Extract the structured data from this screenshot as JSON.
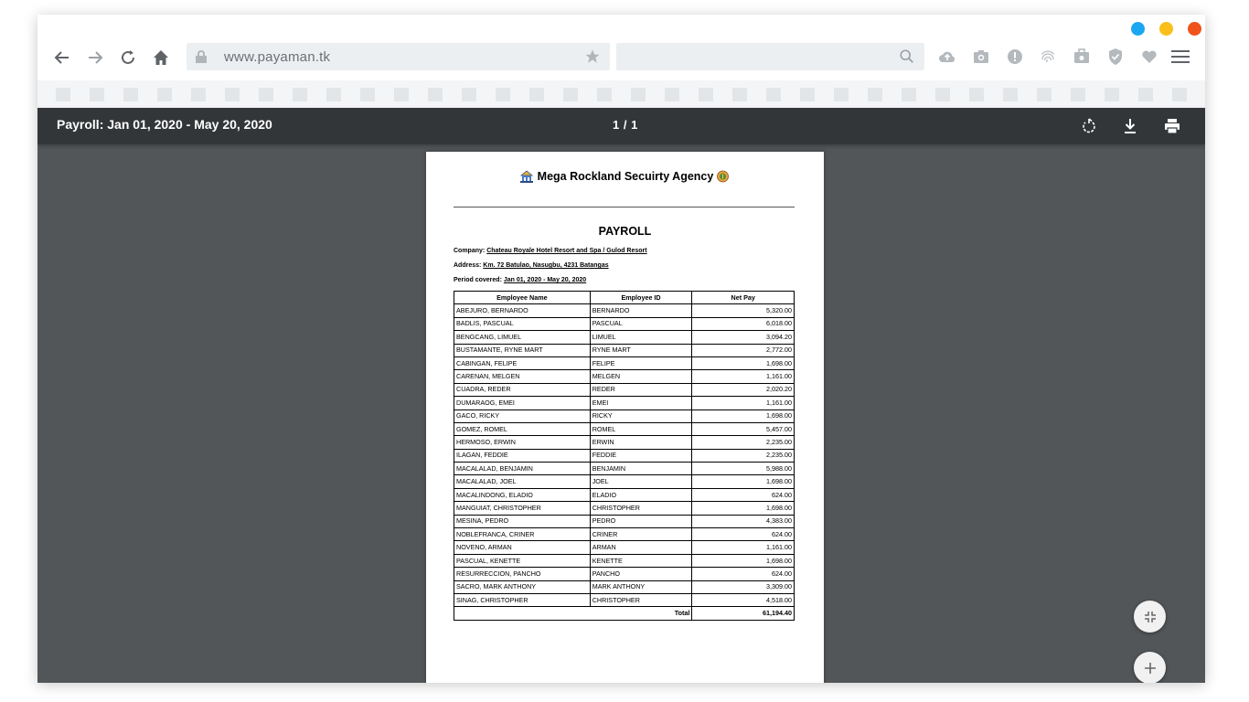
{
  "browser": {
    "window_dots": [
      {
        "name": "blue",
        "color": "#1aa7f0"
      },
      {
        "name": "yellow",
        "color": "#f9bf1a"
      },
      {
        "name": "red",
        "color": "#f0531a"
      }
    ],
    "url": "www.payaman.tk",
    "search_placeholder": "",
    "icons": [
      "back-arrow-icon",
      "forward-arrow-icon",
      "reload-icon",
      "home-icon",
      "lock-icon",
      "star-icon",
      "search-icon",
      "cloud-upload-icon",
      "camera-icon",
      "alert-icon",
      "fingerprint-icon",
      "briefcase-icon",
      "shield-check-icon",
      "heart-icon",
      "menu-icon"
    ]
  },
  "pdf_toolbar": {
    "title": "Payroll: Jan 01, 2020 - May 20, 2020",
    "page_indicator": "1 / 1",
    "icons": [
      "rotate-icon",
      "download-icon",
      "print-icon"
    ]
  },
  "document": {
    "agency_name": "Mega Rockland Secuirty Agency",
    "title": "PAYROLL",
    "company_label": "Company:",
    "company_value": "Chateau Royale Hotel Resort and Spa / Gulod Resort",
    "address_label": "Address:",
    "address_value": "Km. 72 Batulao, Nasugbu, 4231 Batangas",
    "period_label": "Period covered:",
    "period_value": "Jan 01, 2020 - May 20, 2020",
    "columns": [
      "Employee Name",
      "Employee ID",
      "Net Pay"
    ],
    "rows": [
      [
        "ABEJURO, BERNARDO",
        "BERNARDO",
        "5,320.00"
      ],
      [
        "BADLIS, PASCUAL",
        "PASCUAL",
        "6,018.00"
      ],
      [
        "BENGCANG, LIMUEL",
        "LIMUEL",
        "3,094.20"
      ],
      [
        "BUSTAMANTE, RYNE MART",
        "RYNE MART",
        "2,772.00"
      ],
      [
        "CABINGAN, FELIPE",
        "FELIPE",
        "1,698.00"
      ],
      [
        "CARENAN, MELGEN",
        "MELGEN",
        "1,161.00"
      ],
      [
        "CUADRA, REDER",
        "REDER",
        "2,020.20"
      ],
      [
        "DUMARAOG, EMEI",
        "EMEI",
        "1,161.00"
      ],
      [
        "GACO, RICKY",
        "RICKY",
        "1,698.00"
      ],
      [
        "GOMEZ, ROMEL",
        "ROMEL",
        "5,457.00"
      ],
      [
        "HERMOSO, ERWIN",
        "ERWIN",
        "2,235.00"
      ],
      [
        "ILAGAN, FEDDIE",
        "FEDDIE",
        "2,235.00"
      ],
      [
        "MACALALAD, BENJAMIN",
        "BENJAMIN",
        "5,988.00"
      ],
      [
        "MACALALAD, JOEL",
        "JOEL",
        "1,698.00"
      ],
      [
        "MACALINDONG, ELADIO",
        "ELADIO",
        "624.00"
      ],
      [
        "MANGUIAT, CHRISTOPHER",
        "CHRISTOPHER",
        "1,698.00"
      ],
      [
        "MESINA, PEDRO",
        "PEDRO",
        "4,383.00"
      ],
      [
        "NOBLEFRANCA, CRINER",
        "CRINER",
        "624.00"
      ],
      [
        "NOVENO, ARMAN",
        "ARMAN",
        "1,161.00"
      ],
      [
        "PASCUAL, KENETTE",
        "KENETTE",
        "1,698.00"
      ],
      [
        "RESURRECCION, PANCHO",
        "PANCHO",
        "624.00"
      ],
      [
        "SACRO, MARK ANTHONY",
        "MARK ANTHONY",
        "3,309.00"
      ],
      [
        "SINAG, CHRISTOPHER",
        "CHRISTOPHER",
        "4,518.00"
      ]
    ],
    "total_label": "Total",
    "total_value": "61,194.40"
  },
  "viewer_controls": {
    "icons": [
      "fit-page-icon",
      "zoom-in-icon"
    ]
  }
}
